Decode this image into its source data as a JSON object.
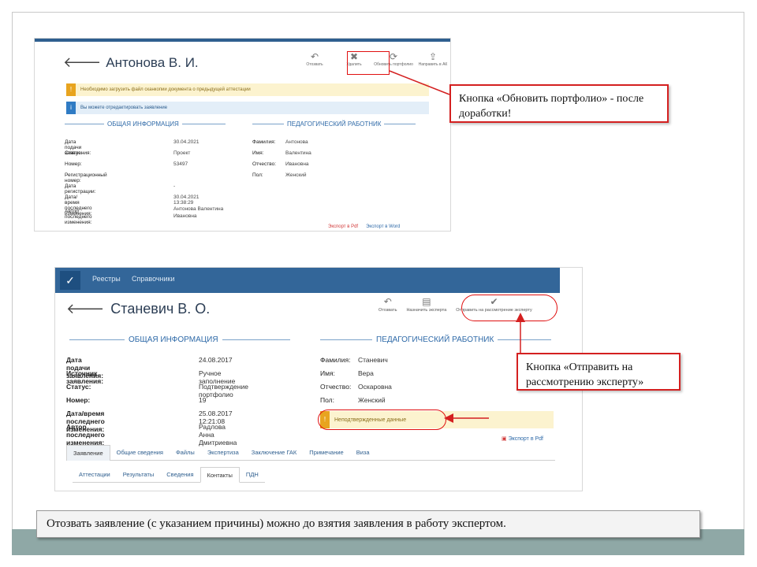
{
  "shot1": {
    "title": "Антонова В. И.",
    "tools": [
      {
        "icon": "undo-icon",
        "glyph": "↶",
        "label": "Отозвать"
      },
      {
        "icon": "close-icon",
        "glyph": "✖",
        "label": "Удалить"
      },
      {
        "icon": "refresh-icon",
        "glyph": "⟳",
        "label": "Обновить портфолио"
      },
      {
        "icon": "send-icon",
        "glyph": "⇪",
        "label": "Направить в АК"
      }
    ],
    "warning": "Необходимо загрузить файл сканкопии документа о предыдущей аттестации",
    "info": "Вы можете отредактировать заявление",
    "section_general": "ОБЩАЯ ИНФОРМАЦИЯ",
    "section_teacher": "ПЕДАГОГИЧЕСКИЙ РАБОТНИК",
    "general": [
      {
        "label": "Дата подачи заявления:",
        "value": "30.04.2021"
      },
      {
        "label": "Статус:",
        "value": "Проект"
      },
      {
        "label": "Номер:",
        "value": "53497"
      },
      {
        "label": "Регистрационный номер:",
        "value": ""
      },
      {
        "label": "Дата регистрации:",
        "value": "-"
      },
      {
        "label": "Дата/время последнего изменения:",
        "value": "30.04.2021 13:38:29"
      },
      {
        "label": "Автор последнего изменения:",
        "value": "Антонова Валентина Ивановна"
      }
    ],
    "teacher": [
      {
        "label": "Фамилия:",
        "value": "Антонова"
      },
      {
        "label": "Имя:",
        "value": "Валентина"
      },
      {
        "label": "Отчество:",
        "value": "Ивановна"
      },
      {
        "label": "Пол:",
        "value": "Женский"
      }
    ],
    "export_pdf": "Экспорт в Pdf",
    "export_word": "Экспорт в Word"
  },
  "callout1": "Кнопка «Обновить портфолио» - после доработки!",
  "shot2": {
    "nav": [
      "Реестры",
      "Справочники"
    ],
    "title": "Станевич В. О.",
    "tools": [
      {
        "icon": "undo-icon",
        "glyph": "↶",
        "label": "Отозвать"
      },
      {
        "icon": "id-card-icon",
        "glyph": "▤",
        "label": "Назначить эксперта"
      },
      {
        "icon": "check-circle-icon",
        "glyph": "✔",
        "label": "Отправить на рассмотрение эксперту"
      }
    ],
    "section_general": "ОБЩАЯ ИНФОРМАЦИЯ",
    "section_teacher": "ПЕДАГОГИЧЕСКИЙ РАБОТНИК",
    "general": [
      {
        "label": "Дата подачи заявления:",
        "value": "24.08.2017"
      },
      {
        "label": "Источник заявления:",
        "value": "Ручное заполнение"
      },
      {
        "label": "Статус:",
        "value": "Подтверждение портфолио"
      },
      {
        "label": "Номер:",
        "value": "19"
      },
      {
        "label": "Дата/время последнего изменения:",
        "value": "25.08.2017 12:21:08"
      },
      {
        "label": "Автор последнего изменения:",
        "value": "Радлова Анна Дмитриевна"
      }
    ],
    "teacher": [
      {
        "label": "Фамилия:",
        "value": "Станевич"
      },
      {
        "label": "Имя:",
        "value": "Вера"
      },
      {
        "label": "Отчество:",
        "value": "Оскаровна"
      },
      {
        "label": "Пол:",
        "value": "Женский"
      }
    ],
    "warning": "Неподтвержденные данные",
    "export_pdf": "Экспорт в Pdf",
    "tabs": [
      "Заявление",
      "Общие сведения",
      "Файлы",
      "Экспертиза",
      "Заключение ГАК",
      "Примечание",
      "Виза"
    ],
    "subtabs": [
      "Аттестации",
      "Результаты",
      "Сведения",
      "Контакты",
      "ПДН"
    ]
  },
  "callout2": "Кнопка «Отправить на рассмотрению эксперту»",
  "note": "Отозвать заявление (с указанием причины) можно до взятия заявления в работу экспертом.",
  "colors": {
    "accent_red": "#e01010",
    "nav_blue": "#336699",
    "band": "#8fa8a6"
  }
}
